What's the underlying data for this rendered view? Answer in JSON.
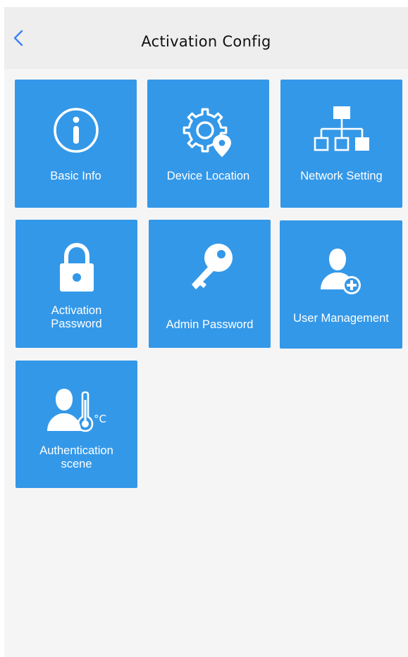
{
  "header": {
    "title": "Activation Config",
    "back_icon": "chevron-left-icon"
  },
  "colors": {
    "tile_background": "#3498e8",
    "screen_background": "#f5f5f5",
    "header_background": "#eeeeee",
    "back_icon": "#3b82f6"
  },
  "tiles": [
    {
      "label": "Basic Info",
      "icon": "info-circle-icon"
    },
    {
      "label": "Device Location",
      "icon": "gear-location-icon"
    },
    {
      "label": "Network Setting",
      "icon": "network-icon"
    },
    {
      "label_line1": "Activation",
      "label_line2": "Password",
      "icon": "lock-icon"
    },
    {
      "label": "Admin Password",
      "icon": "key-icon"
    },
    {
      "label": "User Management",
      "icon": "add-user-icon"
    },
    {
      "label_line1": "Authentication",
      "label_line2": "scene",
      "icon": "person-thermometer-icon",
      "unit_text": "°C"
    }
  ]
}
